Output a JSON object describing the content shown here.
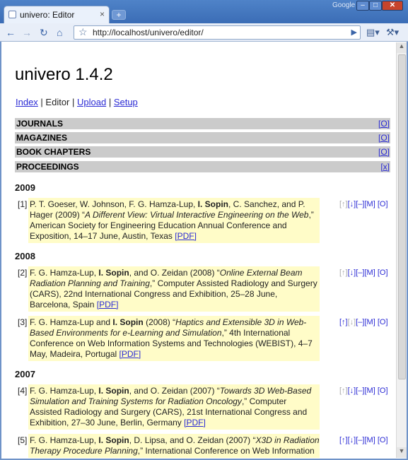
{
  "browser": {
    "tab_title": "univero: Editor",
    "tab_close": "×",
    "new_tab": "+",
    "brand": "Google",
    "url": "http://localhost/univero/editor/",
    "win_min": "–",
    "win_max": "□",
    "win_close": "✕"
  },
  "page": {
    "title": "univero 1.4.2",
    "menu": {
      "index": "Index",
      "sep1": " | ",
      "editor": "Editor",
      "sep2": " | ",
      "upload": "Upload",
      "sep3": " | ",
      "setup": "Setup"
    }
  },
  "categories": [
    {
      "label": "JOURNALS",
      "toggle": "[O]"
    },
    {
      "label": "MAGAZINES",
      "toggle": "[O]"
    },
    {
      "label": "BOOK CHAPTERS",
      "toggle": "[O]"
    },
    {
      "label": "PROCEEDINGS",
      "toggle": "[x]"
    }
  ],
  "years": {
    "y2009": "2009",
    "y2008": "2008",
    "y2007": "2007"
  },
  "controls": {
    "up": "[↑]",
    "down": "[↓]",
    "minus": "[–]",
    "m": "[M]",
    "o": "[O]"
  },
  "entries": [
    {
      "num": "[1]",
      "authors_pre": "P. T. Goeser, W. Johnson, F. G. Hamza-Lup, ",
      "bold_author": "I. Sopin",
      "authors_post": ", C. Sanchez, and P. Hager (2009) “",
      "title": "A Different View: Virtual Interactive Engineering on the Web",
      "rest": ",” American Society for Engineering Education Annual Conference and Exposition, 14–17 June, Austin, Texas ",
      "pdf": "[PDF]"
    },
    {
      "num": "[2]",
      "authors_pre": "F. G. Hamza-Lup, ",
      "bold_author": "I. Sopin",
      "authors_post": ", and O. Zeidan (2008) “",
      "title": "Online External Beam Radiation Planning and Training",
      "rest": ",” Computer Assisted Radiology and Surgery (CARS), 22nd International Congress and Exhibition, 25–28 June, Barcelona, Spain ",
      "pdf": "[PDF]"
    },
    {
      "num": "[3]",
      "authors_pre": "F. G. Hamza-Lup and ",
      "bold_author": "I. Sopin",
      "authors_post": " (2008) “",
      "title": "Haptics and Extensible 3D in Web-Based Environments for e-Learning and Simulation",
      "rest": ",” 4th International Conference on Web Information Systems and Technologies (WEBIST), 4–7 May, Madeira, Portugal ",
      "pdf": "[PDF]"
    },
    {
      "num": "[4]",
      "authors_pre": "F. G. Hamza-Lup, ",
      "bold_author": "I. Sopin",
      "authors_post": ", and O. Zeidan (2007) “",
      "title": "Towards 3D Web-Based Simulation and Training Systems for Radiation Oncology",
      "rest": ",” Computer Assisted Radiology and Surgery (CARS), 21st International Congress and Exhibition, 27–30 June, Berlin, Germany ",
      "pdf": "[PDF]"
    },
    {
      "num": "[5]",
      "authors_pre": "F. G. Hamza-Lup, ",
      "bold_author": "I. Sopin",
      "authors_post": ", D. Lipsa, and O. Zeidan (2007) “",
      "title": "X3D in Radiation Therapy Procedure Planning",
      "rest": ",” International Conference on Web Information",
      "pdf": ""
    }
  ]
}
